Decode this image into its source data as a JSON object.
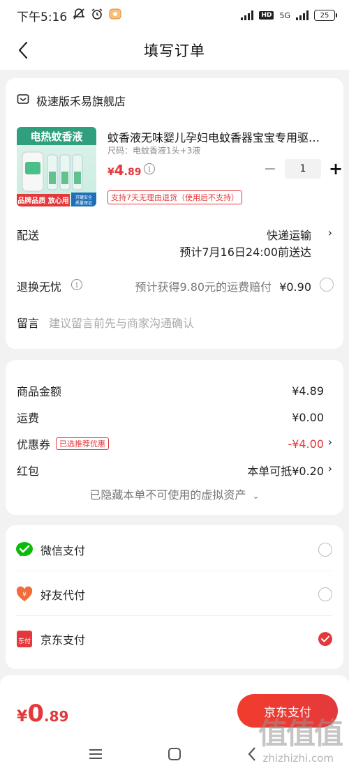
{
  "status_bar": {
    "time": "下午5:16",
    "network": "5G",
    "hd": "HD",
    "battery": "25"
  },
  "header": {
    "title": "填写订单"
  },
  "shop": {
    "name": "极速版禾易旗舰店"
  },
  "product": {
    "image_labels": {
      "top": "电热蚊香液",
      "bottom_left": "品牌品质 放心用",
      "bottom_right_1": "开罐安全",
      "bottom_right_2": "质量保证"
    },
    "title": "蚊香液无味婴儿孕妇电蚊香器宝宝专用驱…",
    "spec": "尺码：电蚊香液1头+3液",
    "price_yen": "¥",
    "price_int": "4",
    "price_dec": ".89",
    "quantity": "1",
    "minus": "−",
    "plus": "+",
    "return_policy": "支持7天无理由退货（使用后不支持）"
  },
  "delivery": {
    "label": "配送",
    "method": "快递运输",
    "eta": "预计7月16日24:00前送达"
  },
  "worry_free": {
    "label": "退换无忧",
    "desc": "预计获得9.80元的运费赔付",
    "price": "¥0.90"
  },
  "message": {
    "label": "留言",
    "placeholder": "建议留言前先与商家沟通确认"
  },
  "summary": {
    "goods_label": "商品金额",
    "goods_value": "¥4.89",
    "shipping_label": "运费",
    "shipping_value": "¥0.00",
    "coupon_label": "优惠券",
    "coupon_tag": "已选推荐优惠",
    "coupon_value": "-¥4.00",
    "redpacket_label": "红包",
    "redpacket_value": "本单可抵¥0.20",
    "hidden_note": "已隐藏本单不可使用的虚拟资产"
  },
  "payment": {
    "methods": [
      {
        "label": "微信支付",
        "icon": "wechat-pay-icon",
        "selected": false
      },
      {
        "label": "好友代付",
        "icon": "friend-pay-icon",
        "selected": false
      },
      {
        "label": "京东支付",
        "icon": "jd-pay-icon",
        "selected": true
      }
    ],
    "jd_icon_text": "东付"
  },
  "footer": {
    "total_yen": "¥",
    "total_int": "0",
    "total_dec": ".89",
    "pay_button": "京东支付"
  },
  "watermark": {
    "logo": "值值值",
    "site": "zhizhizhi.com"
  },
  "colors": {
    "accent": "#e4393c",
    "wechat": "#09bb07"
  }
}
